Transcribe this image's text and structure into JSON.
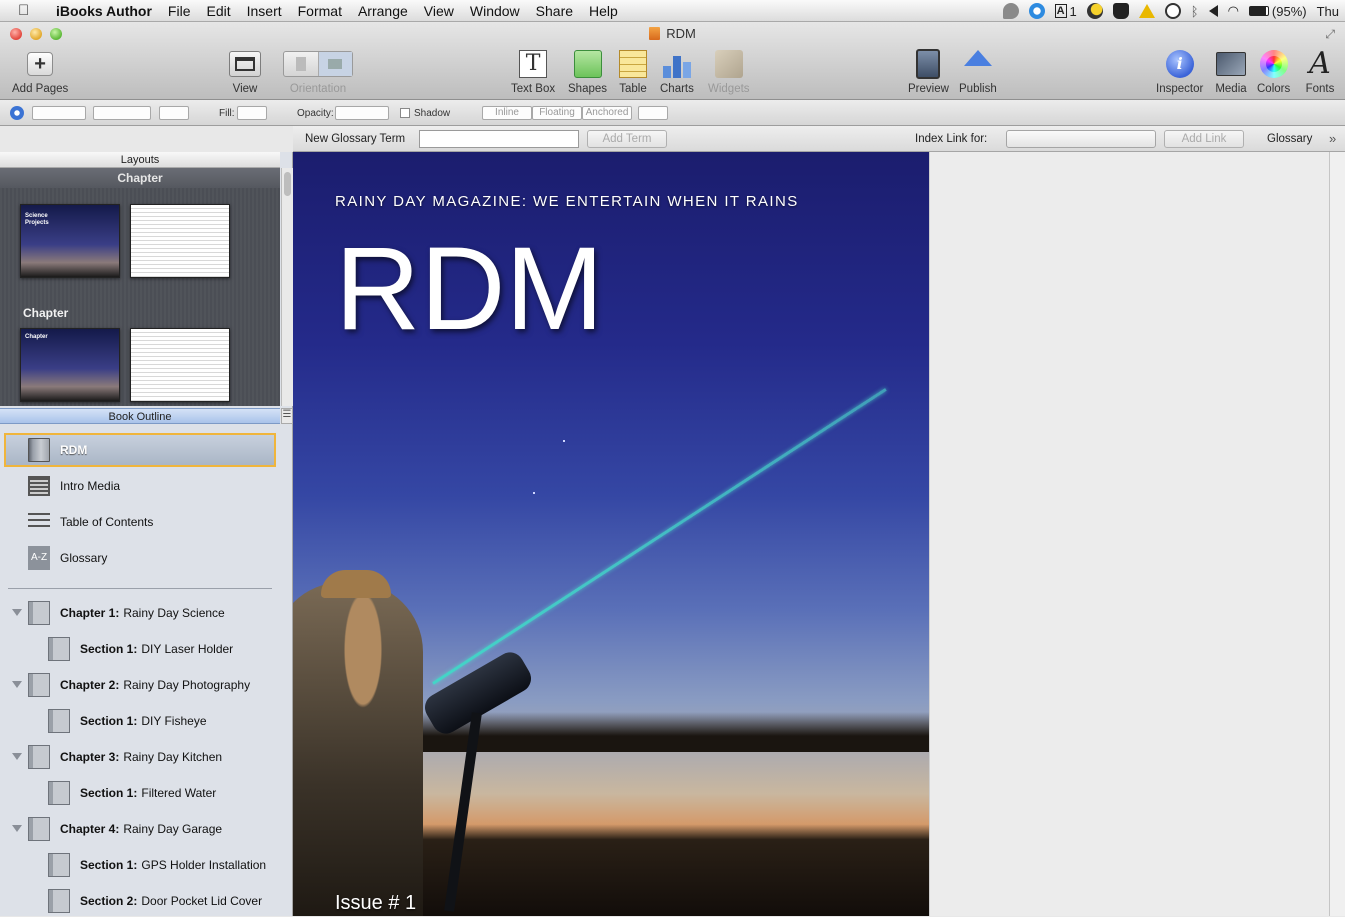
{
  "menubar": {
    "app": "iBooks Author",
    "items": [
      "File",
      "Edit",
      "Insert",
      "Format",
      "Arrange",
      "View",
      "Window",
      "Share",
      "Help"
    ],
    "status": {
      "adobe_count": "1",
      "battery": "(95%)",
      "day": "Thu"
    }
  },
  "window": {
    "title": "RDM"
  },
  "toolbar": {
    "add_pages": "Add Pages",
    "view": "View",
    "orientation": "Orientation",
    "text_box": "Text Box",
    "shapes": "Shapes",
    "table": "Table",
    "charts": "Charts",
    "widgets": "Widgets",
    "preview": "Preview",
    "publish": "Publish",
    "inspector": "Inspector",
    "media": "Media",
    "colors": "Colors",
    "fonts": "Fonts"
  },
  "formatbar": {
    "fill": "Fill:",
    "opacity": "Opacity:",
    "shadow": "Shadow",
    "inline": "Inline",
    "floating": "Floating",
    "anchored": "Anchored"
  },
  "glossbar": {
    "new_term": "New Glossary Term",
    "add_term": "Add Term",
    "index_link": "Index Link for:",
    "add_link": "Add Link",
    "glossary": "Glossary"
  },
  "sidebar": {
    "layouts_header": "Layouts",
    "chapter_header": "Chapter",
    "layout_label": "Chapter",
    "thumb1_title": "Science Projects",
    "thumb3_title": "Chapter",
    "outline_header": "Book Outline",
    "items": [
      {
        "label": "RDM"
      },
      {
        "label": "Intro Media"
      },
      {
        "label": "Table of Contents"
      },
      {
        "label": "Glossary",
        "icon_text": "A-Z"
      }
    ],
    "chapters": [
      {
        "prefix": "Chapter 1:",
        "title": "Rainy Day Science"
      },
      {
        "prefix": "Section 1:",
        "title": "DIY Laser Holder"
      },
      {
        "prefix": "Chapter 2:",
        "title": "Rainy Day Photography"
      },
      {
        "prefix": "Section 1:",
        "title": "DIY Fisheye"
      },
      {
        "prefix": "Chapter 3:",
        "title": "Rainy Day Kitchen"
      },
      {
        "prefix": "Section 1:",
        "title": "Filtered Water"
      },
      {
        "prefix": "Chapter 4:",
        "title": "Rainy Day Garage"
      },
      {
        "prefix": "Section 1:",
        "title": "GPS Holder Installation"
      },
      {
        "prefix": "Section 2:",
        "title": "Door Pocket Lid Cover"
      }
    ]
  },
  "cover": {
    "tagline": "RAINY DAY MAGAZINE: WE ENTERTAIN WHEN IT RAINS",
    "title": "RDM",
    "issue": "Issue # 1"
  }
}
